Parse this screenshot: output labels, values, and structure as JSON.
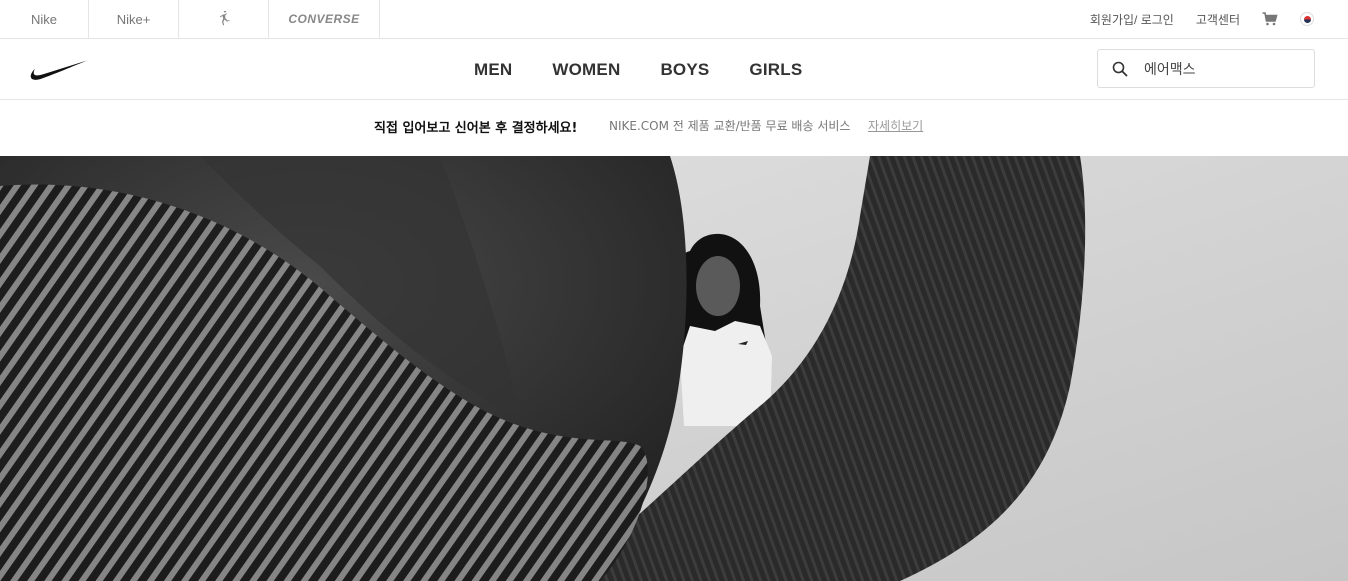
{
  "utility": {
    "brands": [
      {
        "label": "Nike"
      },
      {
        "label": "Nike+"
      },
      {
        "label": "Jordan",
        "icon": "jumpman-icon"
      },
      {
        "label": "CONVERSE"
      }
    ],
    "join_login": "회원가입/ 로그인",
    "customer_service": "고객센터",
    "cart_icon": "cart-icon",
    "locale_icon": "korea-flag-icon"
  },
  "header": {
    "logo_icon": "nike-swoosh-icon",
    "nav": [
      "MEN",
      "WOMEN",
      "BOYS",
      "GIRLS"
    ],
    "search": {
      "icon": "search-icon",
      "value": "에어맥스"
    }
  },
  "promo": {
    "headline": "직접 입어보고 신어본 후 결정하세요!",
    "subtext": "NIKE.COM 전 제품 교환/반품 무료 배송 서비스",
    "link": "자세히보기"
  },
  "colors": {
    "border": "#e5e5e5",
    "nav_text": "#333333",
    "muted_text": "#777777"
  }
}
